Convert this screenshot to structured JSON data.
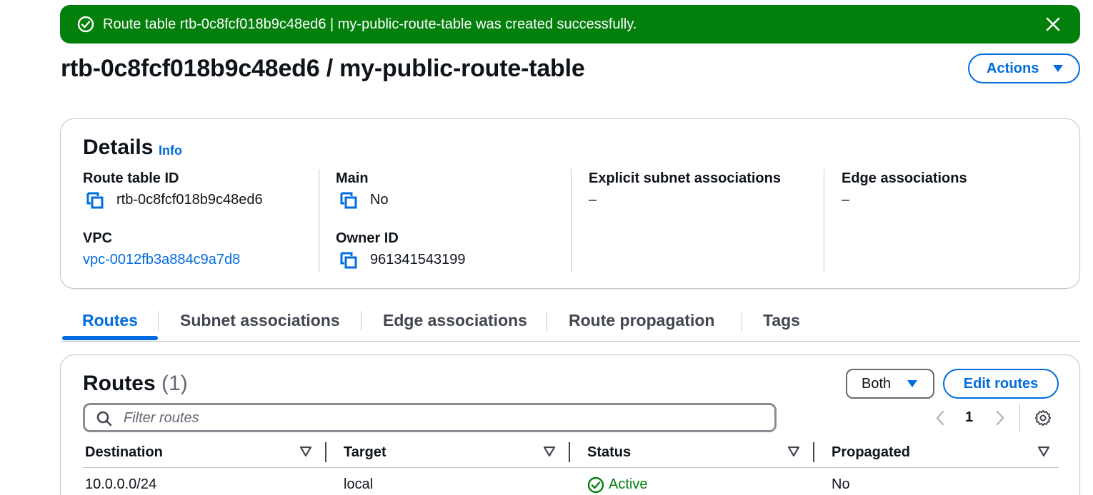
{
  "flash": {
    "message": "Route table rtb-0c8fcf018b9c48ed6 | my-public-route-table was created successfully.",
    "color": "#037f0c"
  },
  "header": {
    "title": "rtb-0c8fcf018b9c48ed6 / my-public-route-table",
    "actions_label": "Actions"
  },
  "details": {
    "title": "Details",
    "info_label": "Info",
    "route_table_id": {
      "label": "Route table ID",
      "value": "rtb-0c8fcf018b9c48ed6"
    },
    "vpc": {
      "label": "VPC",
      "value": "vpc-0012fb3a884c9a7d8"
    },
    "main": {
      "label": "Main",
      "value": "No"
    },
    "owner_id": {
      "label": "Owner ID",
      "value": "961341543199"
    },
    "explicit_subnet": {
      "label": "Explicit subnet associations",
      "value": "–"
    },
    "edge_assoc": {
      "label": "Edge associations",
      "value": "–"
    }
  },
  "tabs": [
    {
      "label": "Routes",
      "active": true
    },
    {
      "label": "Subnet associations",
      "active": false
    },
    {
      "label": "Edge associations",
      "active": false
    },
    {
      "label": "Route propagation",
      "active": false
    },
    {
      "label": "Tags",
      "active": false
    }
  ],
  "routes": {
    "title": "Routes",
    "count": "(1)",
    "filter_dropdown": "Both",
    "edit_label": "Edit routes",
    "filter_placeholder": "Filter routes",
    "page": "1",
    "columns": [
      "Destination",
      "Target",
      "Status",
      "Propagated"
    ],
    "rows": [
      {
        "destination": "10.0.0.0/24",
        "target": "local",
        "status": "Active",
        "propagated": "No"
      }
    ]
  },
  "colors": {
    "accent": "#006ce0",
    "success": "#037f0c",
    "border": "#c6c6cd"
  }
}
